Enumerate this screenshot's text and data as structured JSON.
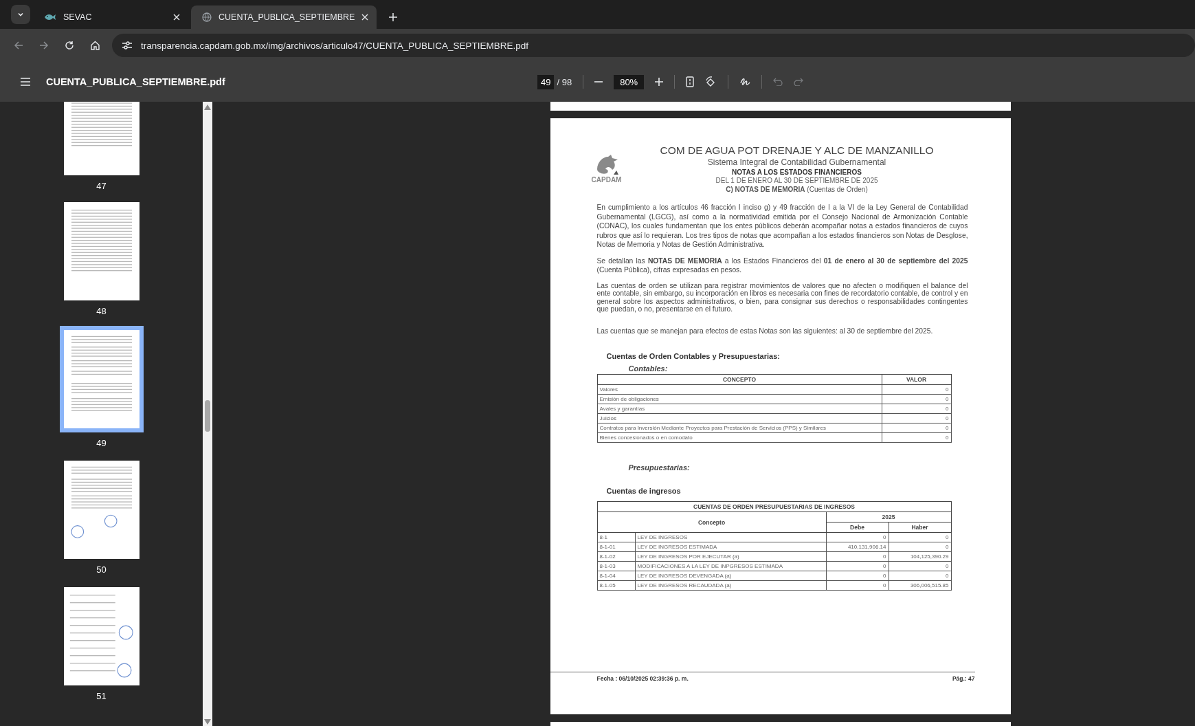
{
  "browser": {
    "tabs": [
      {
        "title": "SEVAC",
        "selected": false,
        "kind": "logo"
      },
      {
        "title": "CUENTA_PUBLICA_SEPTIEMBRE",
        "selected": true,
        "kind": "globe"
      }
    ],
    "url": "transparencia.capdam.gob.mx/img/archivos/articulo47/CUENTA_PUBLICA_SEPTIEMBRE.pdf"
  },
  "pdf_toolbar": {
    "title": "CUENTA_PUBLICA_SEPTIEMBRE.pdf",
    "page": "49",
    "page_total": "/ 98",
    "zoom": "80%"
  },
  "sidebar": {
    "thumbnails": [
      {
        "label": "47",
        "selected": false,
        "kind": "list"
      },
      {
        "label": "48",
        "selected": false,
        "kind": "list"
      },
      {
        "label": "49",
        "selected": true,
        "kind": "notes"
      },
      {
        "label": "50",
        "selected": false,
        "kind": "signatures"
      },
      {
        "label": "51",
        "selected": false,
        "kind": "rotated"
      }
    ]
  },
  "document": {
    "logo_text": "CAPDAM",
    "organization": "COM DE AGUA POT DRENAJE Y ALC DE MANZANILLO",
    "system": "Sistema Integral de Contabilidad Gubernamental",
    "title": "NOTAS A LOS ESTADOS FINANCIEROS",
    "period": "DEL 1 DE ENERO AL 30 DE SEPTIEMBRE DE 2025",
    "section": "**C) NOTAS DE MEMORIA** (Cuentas de Orden)",
    "paragraphs": [
      "En cumplimiento a los artículos 46 fracción I inciso g) y 49 fracción de I a la VI de la Ley General de Contabilidad Gubernamental (LGCG), así como a la normatividad emitida por el Consejo Nacional de Armonización Contable (CONAC), los cuales fundamentan que los entes públicos deberán acompañar notas a estados financieros de cuyos rubros que así lo requieran. Los tres tipos de notas que acompañan a los estados financieros son Notas de Desglose, Notas de Memoria y Notas de Gestión Administrativa.",
      "Se detallan las **NOTAS DE MEMORIA** a los Estados Financieros del **01 de enero al 30 de septiembre del 2025** (Cuenta Pública), cifras expresadas en pesos.",
      "Las cuentas de orden se utilizan para registrar movimientos de valores que no afecten o modifiquen el balance del ente contable, sin embargo, su incorporación en libros es necesaria con fines de recordatorio contable, de control y en general sobre los aspectos administrativos, o bien, para consignar sus derechos o responsabilidades contingentes que puedan, o no, presentarse en el futuro.",
      "Las cuentas que se manejan para efectos de estas Notas son las siguientes:  al 30 de septiembre del 2025."
    ],
    "heading": "Cuentas de Orden Contables y Presupuestarias:",
    "contables_label": "Contables:",
    "contables": {
      "columns": [
        "CONCEPTO",
        "VALOR"
      ],
      "rows": [
        {
          "concepto": "Valores",
          "valor": "0"
        },
        {
          "concepto": "Emisión de obligaciones",
          "valor": "0"
        },
        {
          "concepto": "Avales y garantías",
          "valor": "0"
        },
        {
          "concepto": "Juicios",
          "valor": "0"
        },
        {
          "concepto": "Contratos para Inversión Mediante Proyectos para Prestación de Servicios (PPS) y Similares",
          "valor": "0"
        },
        {
          "concepto": "Bienes concesionados o en comodato",
          "valor": "0"
        }
      ]
    },
    "presupuestarias_label": "Presupuestarias:",
    "ingresos_heading": "Cuentas de ingresos",
    "ingresos": {
      "title": "CUENTAS DE ORDEN PRESUPUESTARIAS DE INGRESOS",
      "concept_header": "Concepto",
      "year": "2025",
      "debe_header": "Debe",
      "haber_header": "Haber",
      "rows": [
        {
          "code": "8-1",
          "name": "LEY DE INGRESOS",
          "debe": "0",
          "haber": "0"
        },
        {
          "code": "8-1-01",
          "name": "LEY DE INGRESOS ESTIMADA",
          "debe": "410,131,906.14",
          "haber": "0"
        },
        {
          "code": "8-1-02",
          "name": "LEY DE INGRESOS POR EJECUTAR (a)",
          "debe": "0",
          "haber": "104,125,390.29"
        },
        {
          "code": "8-1-03",
          "name": "MODIFICACIONES A LA LEY DE INPGRESOS ESTIMADA",
          "debe": "0",
          "haber": "0"
        },
        {
          "code": "8-1-04",
          "name": "LEY DE INGRESOS DEVENGADA (a)",
          "debe": "0",
          "haber": "0"
        },
        {
          "code": "8-1-05",
          "name": "LEY DE INGRESOS RECAUDADA (a)",
          "debe": "0",
          "haber": "306,006,515.85"
        }
      ]
    },
    "footer_date": "Fecha : 06/10/2025 02:39:36 p. m.",
    "footer_page": "Pág.: 47"
  }
}
